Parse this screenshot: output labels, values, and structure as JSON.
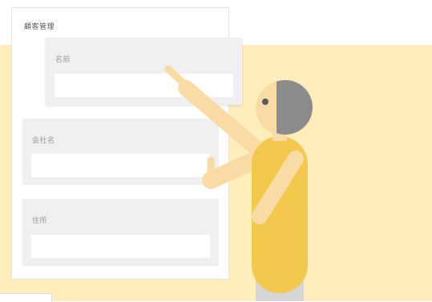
{
  "form": {
    "title": "顧客管理",
    "fields": [
      {
        "label": "名前",
        "value": ""
      },
      {
        "label": "会社名",
        "value": ""
      },
      {
        "label": "住所",
        "value": ""
      }
    ]
  },
  "colors": {
    "background_band": "#ffedbb",
    "field_block": "#f0f0f0",
    "shirt": "#f2c94c",
    "skin": "#f9dca5",
    "hair": "#8c8c8c",
    "pants": "#d6d6d6"
  }
}
